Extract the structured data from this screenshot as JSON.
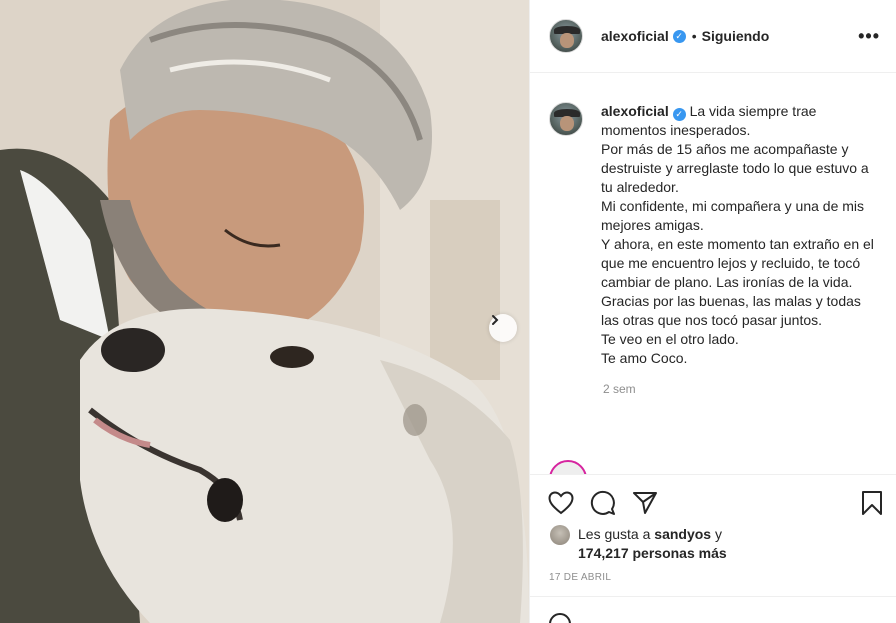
{
  "post": {
    "username": "alexoficial",
    "follow_status": "Siguiendo",
    "more_label": "•••",
    "caption_lines": [
      "La vida siempre trae momentos inesperados.",
      "Por más de 15 años me acompañaste y destruiste y arreglaste todo lo que estuvo a tu alrededor.",
      "Mi confidente, mi compañera y una de mis mejores amigas.",
      "Y ahora, en este momento tan extraño en el que me encuentro lejos y recluido, te tocó cambiar de plano. Las ironías de la vida.",
      "Gracias por las buenas, las malas y todas las otras que nos tocó pasar juntos.",
      "Te veo en el otro lado.",
      "Te amo Coco."
    ],
    "caption_age": "2 sem",
    "likes_prefix": "Les gusta a",
    "liked_by": "sandyos",
    "likes_joiner": "y",
    "likes_count": "174,217 personas más",
    "date": "17 DE ABRIL"
  },
  "icons": {
    "like": "heart-icon",
    "comment": "comment-icon",
    "share": "paper-plane-icon",
    "save": "bookmark-icon",
    "next": "chevron-right-icon",
    "verified": "verified-badge-icon"
  },
  "colors": {
    "verified": "#3897f0",
    "text": "#262626",
    "muted": "#8e8e8e",
    "story_ring": "#d6249f"
  }
}
